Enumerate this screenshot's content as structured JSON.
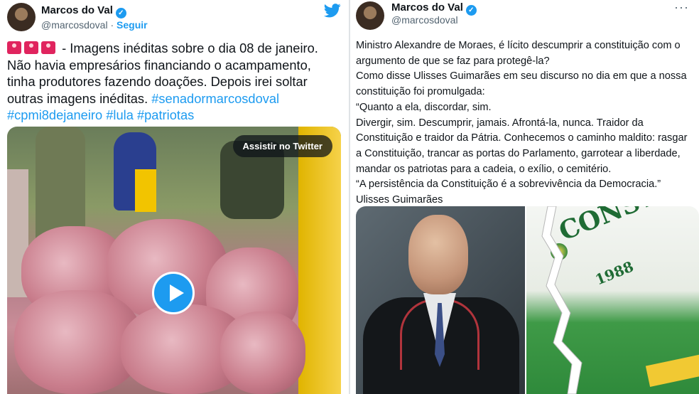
{
  "tweet1": {
    "name": "Marcos do Val",
    "handle": "@marcosdoval",
    "separator": "·",
    "follow_label": "Seguir",
    "text_main": " - Imagens inéditas sobre o dia 08 de janeiro. Não havia empresários financiando o acampamento, tinha produtores fazendo doações. Depois irei soltar outras imagens inéditas. ",
    "hashtags": [
      "#senadormarcosdoval",
      "#cpmi8dejaneiro",
      "#lula",
      "#patriotas"
    ],
    "emoji": "rotating-light-emoji",
    "video": {
      "watch_label": "Assistir no Twitter",
      "icon": "play-icon"
    }
  },
  "tweet2": {
    "name": "Marcos do Val",
    "handle": "@marcosdoval",
    "more_label": "···",
    "lines": [
      "Ministro Alexandre de Moraes, é lícito descumprir a constituição com o argumento de que se faz para protegê-la?",
      "Como disse Ulisses Guimarães em seu discurso no dia em que a nossa constituição foi promulgada:",
      "“Quanto a ela, discordar, sim.",
      "Divergir, sim. Descumprir, jamais. Afrontá-la, nunca. Traidor da Constituição e traidor da Pátria. Conhecemos o caminho maldito: rasgar a Constituição, trancar as portas do Parlamento, garrotear a liberdade, mandar os patriotas para a cadeia, o exílio, o cemitério.",
      "“A persistência da Constituição é a sobrevivência da Democracia.”",
      "Ulisses Guimarães"
    ],
    "image_right_text": "CONSTITUIÇÃO",
    "image_right_year": "1988"
  },
  "colors": {
    "accent": "#1d9bf0",
    "text": "#0f1419",
    "muted": "#536471"
  }
}
